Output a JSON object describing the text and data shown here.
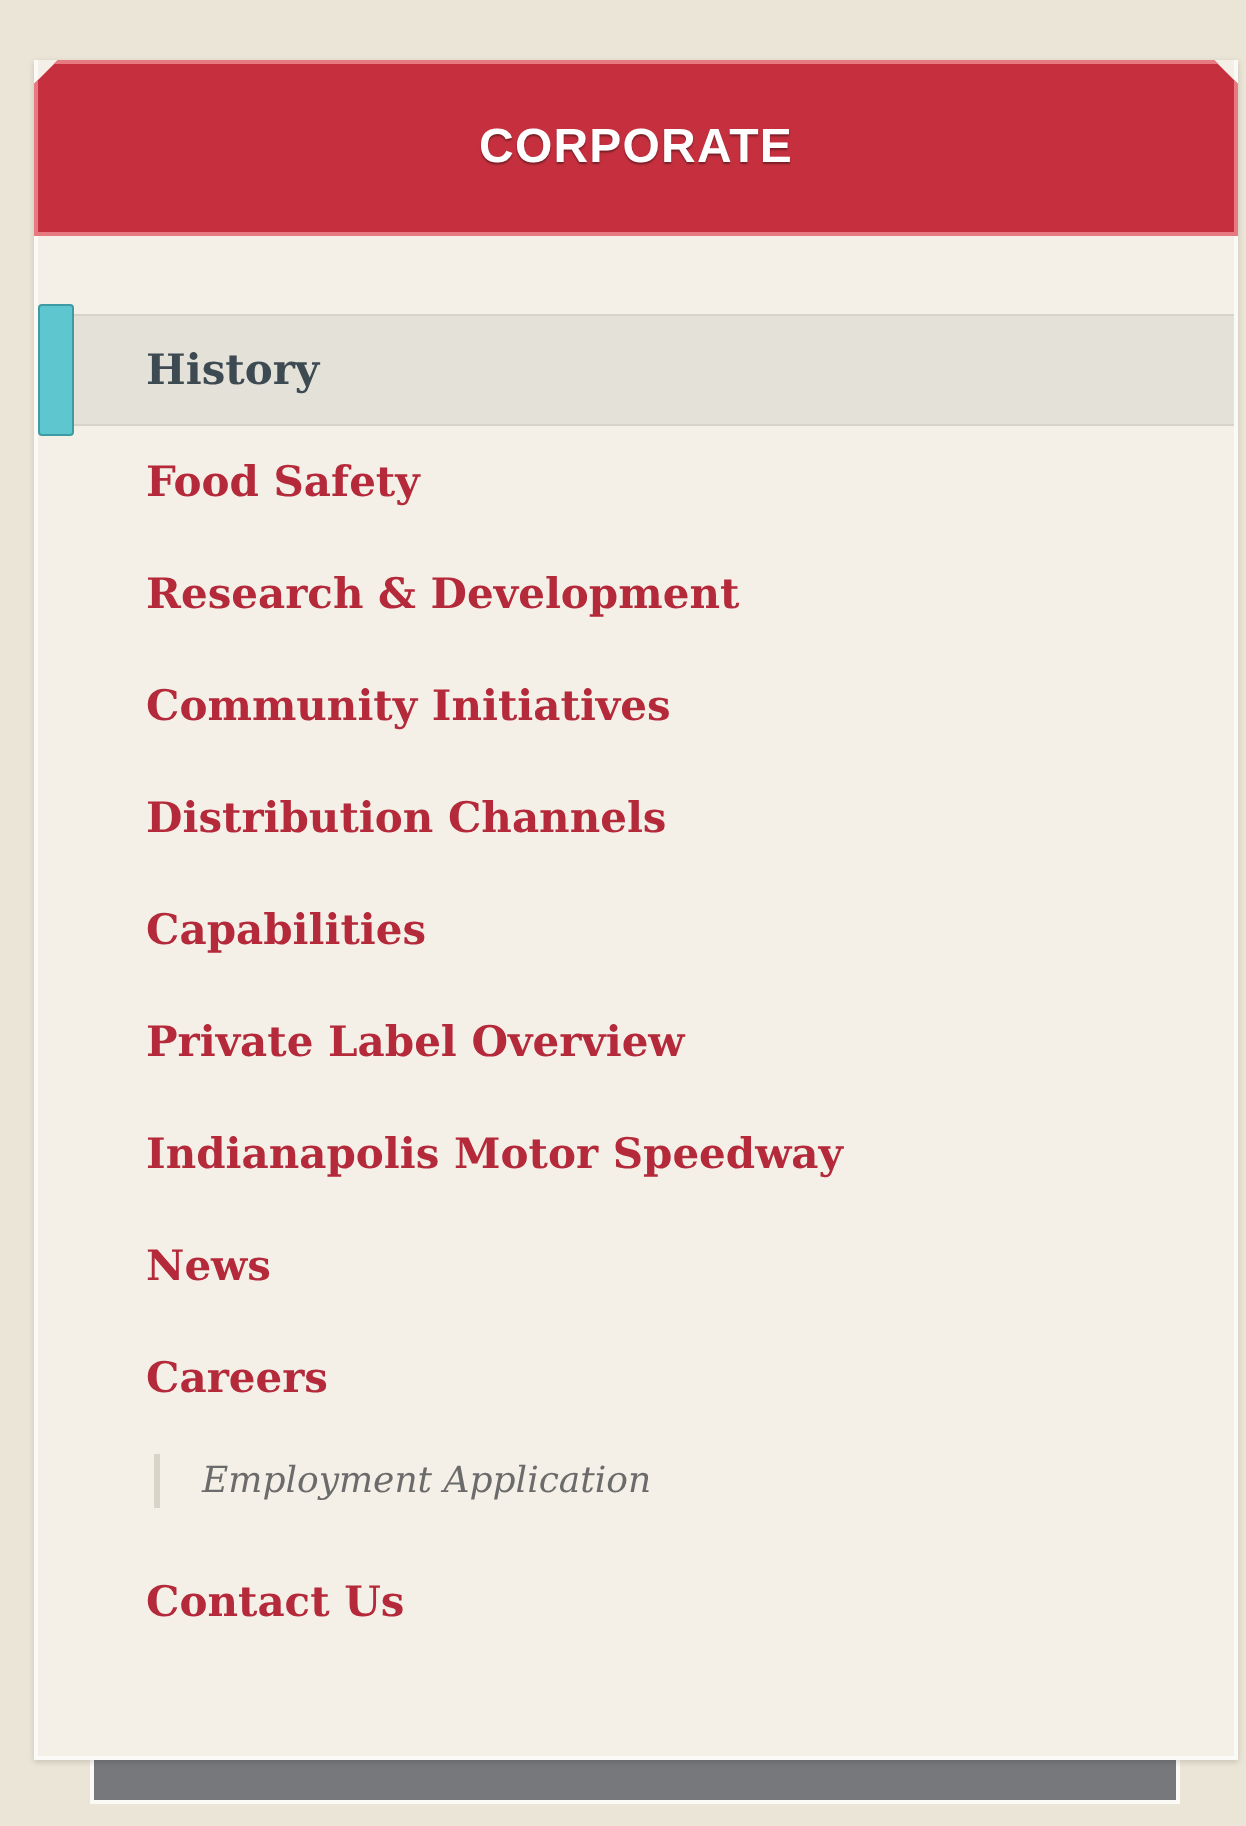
{
  "header": {
    "title": "CORPORATE"
  },
  "menu": [
    {
      "label": "History",
      "selected": true
    },
    {
      "label": "Food Safety",
      "selected": false
    },
    {
      "label": "Research & Development",
      "selected": false
    },
    {
      "label": "Community Initiatives",
      "selected": false
    },
    {
      "label": "Distribution Channels",
      "selected": false
    },
    {
      "label": "Capabilities",
      "selected": false
    },
    {
      "label": "Private Label Overview",
      "selected": false
    },
    {
      "label": "Indianapolis Motor Speedway",
      "selected": false
    },
    {
      "label": "News",
      "selected": false
    },
    {
      "label": "Careers",
      "selected": false,
      "children": [
        {
          "label": "Employment Application",
          "selected": false
        }
      ]
    },
    {
      "label": "Contact Us",
      "selected": false
    }
  ]
}
